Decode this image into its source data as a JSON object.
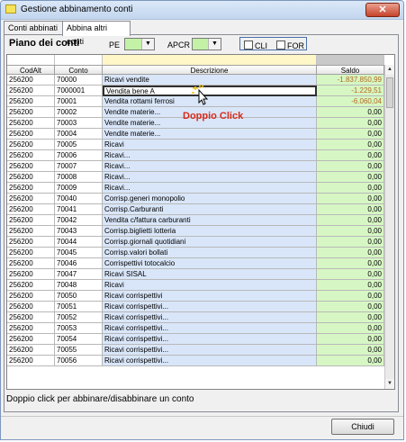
{
  "window": {
    "title": "Gestione abbinamento conti",
    "close_label": "✕"
  },
  "tabs": [
    {
      "label": "Conti abbinati",
      "active": false
    },
    {
      "label": "Abbina altri conti",
      "active": true
    }
  ],
  "panel": {
    "title": "Piano dei conti",
    "pe_label": "PE",
    "pe_value": "",
    "apcr_label": "APCR",
    "apcr_value": "",
    "cli_label": "CLI",
    "for_label": "FOR"
  },
  "grid": {
    "columns": [
      "CodAlt",
      "Conto",
      "Descrizione",
      "Saldo"
    ],
    "rows": [
      {
        "codalt": "256200",
        "conto": "70000",
        "descrizione": "Ricavi vendite",
        "saldo": "-1.837.850,99",
        "negative": true
      },
      {
        "codalt": "256200",
        "conto": "7000001",
        "descrizione": "Vendita bene A",
        "saldo": "-1.229,51",
        "negative": true
      },
      {
        "codalt": "256200",
        "conto": "70001",
        "descrizione": "Vendita rottami ferrosi",
        "saldo": "-6.060,04",
        "negative": true
      },
      {
        "codalt": "256200",
        "conto": "70002",
        "descrizione": "Vendite materie...",
        "saldo": "0,00"
      },
      {
        "codalt": "256200",
        "conto": "70003",
        "descrizione": "Vendite materie...",
        "saldo": "0,00"
      },
      {
        "codalt": "256200",
        "conto": "70004",
        "descrizione": "Vendite materie...",
        "saldo": "0,00"
      },
      {
        "codalt": "256200",
        "conto": "70005",
        "descrizione": "Ricavi",
        "saldo": "0,00"
      },
      {
        "codalt": "256200",
        "conto": "70006",
        "descrizione": "Ricavi...",
        "saldo": "0,00"
      },
      {
        "codalt": "256200",
        "conto": "70007",
        "descrizione": "Ricavi...",
        "saldo": "0,00"
      },
      {
        "codalt": "256200",
        "conto": "70008",
        "descrizione": "Ricavi...",
        "saldo": "0,00"
      },
      {
        "codalt": "256200",
        "conto": "70009",
        "descrizione": "Ricavi...",
        "saldo": "0,00"
      },
      {
        "codalt": "256200",
        "conto": "70040",
        "descrizione": "Corrisp.generi monopolio",
        "saldo": "0,00"
      },
      {
        "codalt": "256200",
        "conto": "70041",
        "descrizione": "Corrisp.Carburanti",
        "saldo": "0,00"
      },
      {
        "codalt": "256200",
        "conto": "70042",
        "descrizione": "Vendita c/fattura carburanti",
        "saldo": "0,00"
      },
      {
        "codalt": "256200",
        "conto": "70043",
        "descrizione": "Corrisp.biglietti lotteria",
        "saldo": "0,00"
      },
      {
        "codalt": "256200",
        "conto": "70044",
        "descrizione": "Corrisp.giornali quotidiani",
        "saldo": "0,00"
      },
      {
        "codalt": "256200",
        "conto": "70045",
        "descrizione": "Corrisp.valori bollati",
        "saldo": "0,00"
      },
      {
        "codalt": "256200",
        "conto": "70046",
        "descrizione": "Corrispettivi totocalcio",
        "saldo": "0,00"
      },
      {
        "codalt": "256200",
        "conto": "70047",
        "descrizione": "Ricavi SISAL",
        "saldo": "0,00"
      },
      {
        "codalt": "256200",
        "conto": "70048",
        "descrizione": "Ricavi",
        "saldo": "0,00"
      },
      {
        "codalt": "256200",
        "conto": "70050",
        "descrizione": "Ricavi corrispettivi",
        "saldo": "0,00"
      },
      {
        "codalt": "256200",
        "conto": "70051",
        "descrizione": "Ricavi corrispettivi...",
        "saldo": "0,00"
      },
      {
        "codalt": "256200",
        "conto": "70052",
        "descrizione": "Ricavi corrispettivi...",
        "saldo": "0,00"
      },
      {
        "codalt": "256200",
        "conto": "70053",
        "descrizione": "Ricavi corrispettivi...",
        "saldo": "0,00"
      },
      {
        "codalt": "256200",
        "conto": "70054",
        "descrizione": "Ricavi corrispettivi...",
        "saldo": "0,00"
      },
      {
        "codalt": "256200",
        "conto": "70055",
        "descrizione": "Ricavi corrispettivi...",
        "saldo": "0,00"
      },
      {
        "codalt": "256200",
        "conto": "70056",
        "descrizione": "Ricavi corrispettivi...",
        "saldo": "0,00"
      }
    ],
    "selected_index": 1
  },
  "annotation": {
    "text": "Doppio Click",
    "icon": "pointer-cursor-icon"
  },
  "footer": {
    "hint": "Doppio click per abbinare/disabbinare un conto",
    "close_button": "Chiudi"
  },
  "colors": {
    "desc_column": "#d9e6f9",
    "saldo_column": "#d6f7c4",
    "negative_amount": "#b46a1f",
    "annotation": "#d92b1a"
  }
}
